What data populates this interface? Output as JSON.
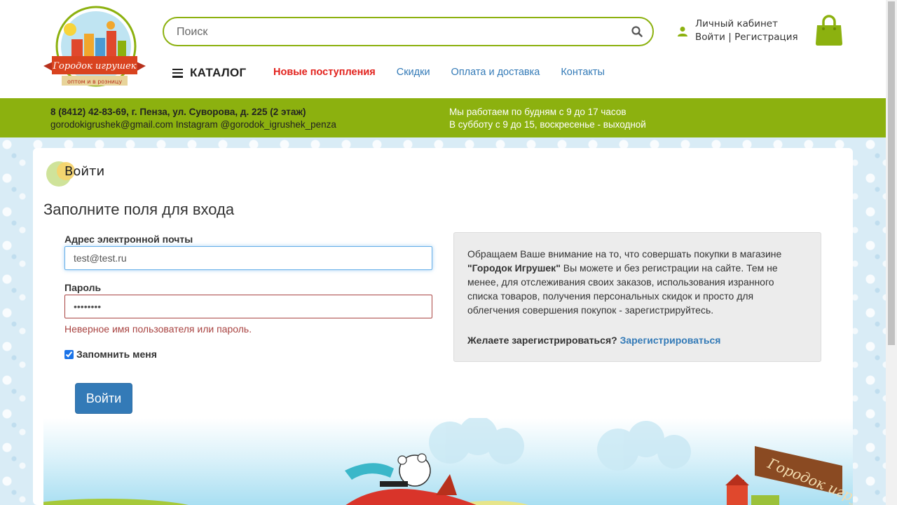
{
  "header": {
    "logo_text": "Городок игрушек",
    "logo_subtext": "оптом и в розницу",
    "search_placeholder": "Поиск",
    "account_title": "Личный кабинет",
    "account_login": "Войти",
    "account_sep": " | ",
    "account_register": "Регистрация",
    "catalog_label": "КАТАЛОГ",
    "nav": [
      {
        "label": "Новые поступления"
      },
      {
        "label": "Скидки"
      },
      {
        "label": "Оплата и доставка"
      },
      {
        "label": "Контакты"
      }
    ],
    "accent_color": "#8cb10f"
  },
  "infobar": {
    "address": "8 (8412) 42-83-69, г. Пенза, ул. Суворова, д. 225 (2 этаж)",
    "contacts": "gorodokigrushek@gmail.com Instagram @gorodok_igrushek_penza",
    "hours_weekdays": "Мы работаем по будням с 9 до 17 часов",
    "hours_weekend": "В субботу с 9 до 15, воскресенье - выходной"
  },
  "page": {
    "breadcrumb": "Войти",
    "title": "Заполните поля для входа",
    "email_label": "Адрес электронной почты",
    "email_value": "test@test.ru",
    "password_label": "Пароль",
    "password_value": "••••••••",
    "error_message": "Неверное имя пользователя или пароль.",
    "remember_label": "Запомнить меня",
    "submit_label": "Войти"
  },
  "notice": {
    "text_before": "Обращаем Ваше внимание на то, что совершать покупки в магазине ",
    "text_bold": "\"Городок Игрушек\"",
    "text_after": " Вы можете и без регистрации на сайте. Тем не менее, для отслеживания своих заказов, использования изранного списка товаров, получения персональных скидок и просто для облегчения совершения покупок - зарегистрируйтесь.",
    "question": "Желаете зарегистрироваться? ",
    "register_link": "Зарегистрироваться"
  },
  "banner": {
    "sign_text": "Городок игрушек"
  }
}
